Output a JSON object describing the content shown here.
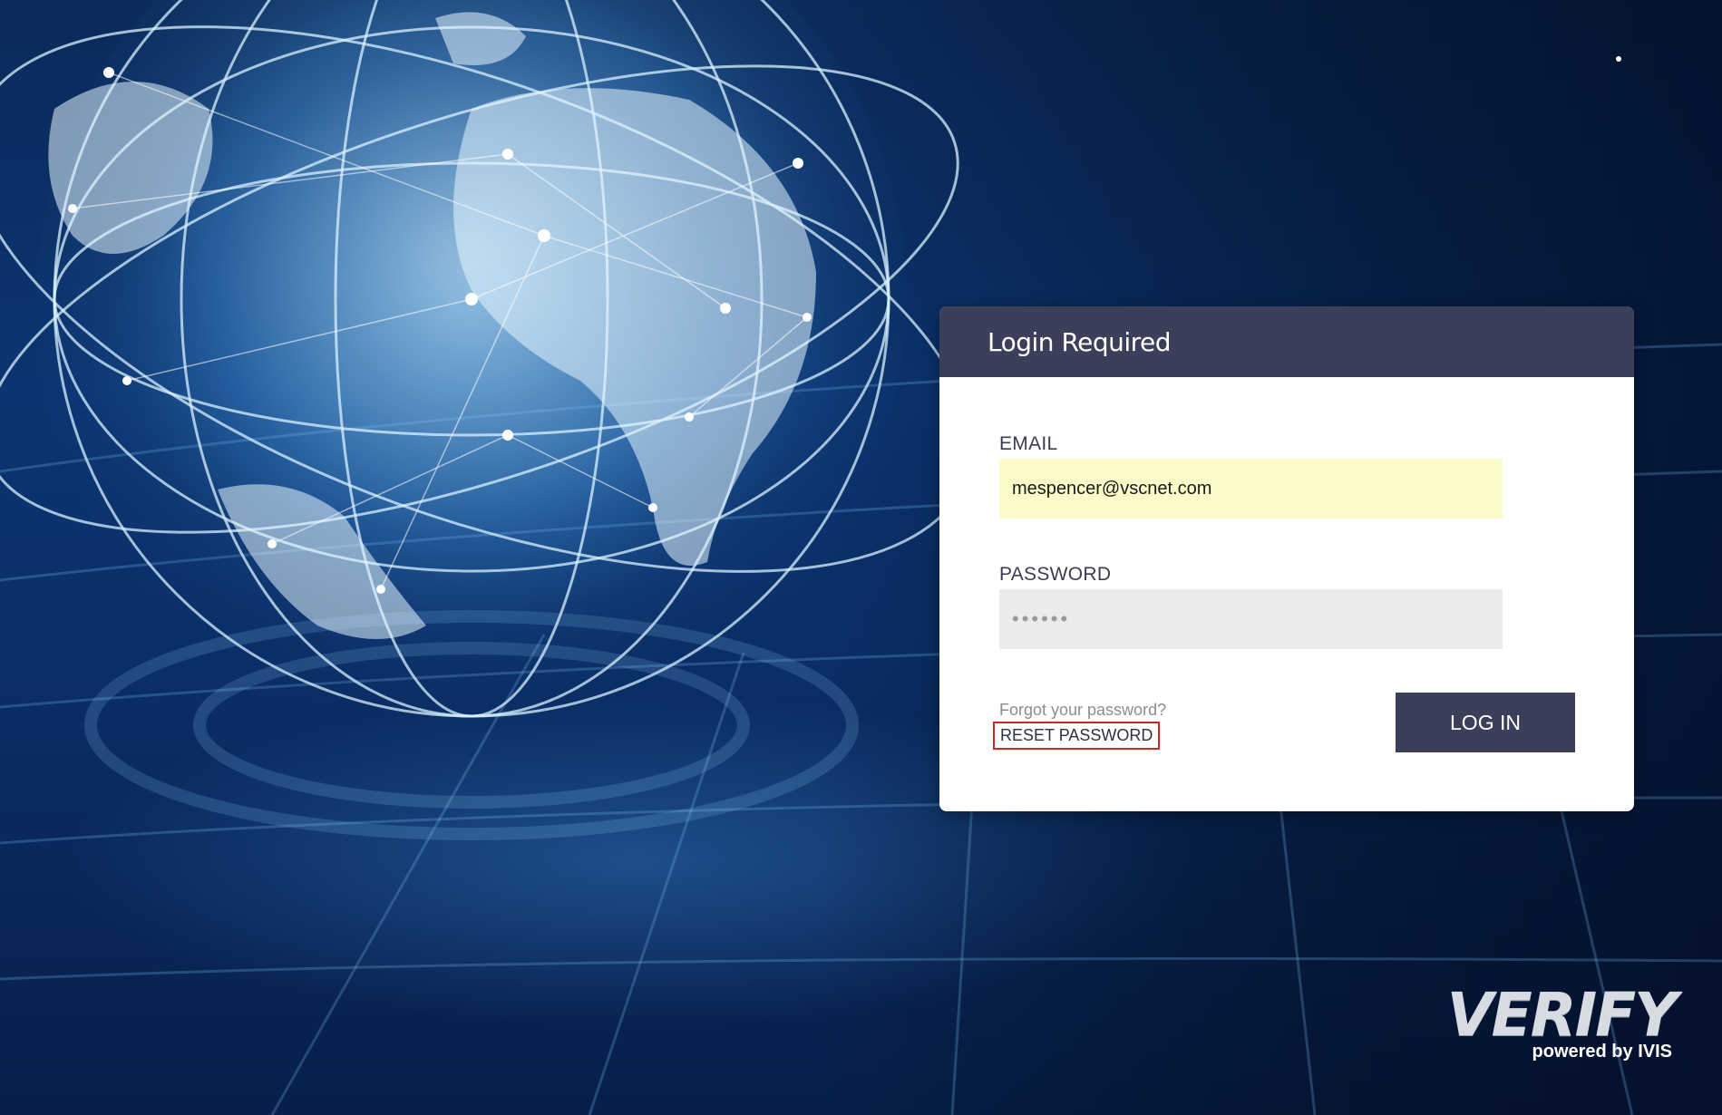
{
  "login": {
    "title": "Login Required",
    "email_label": "EMAIL",
    "email_value": "mespencer@vscnet.com",
    "password_label": "PASSWORD",
    "password_value": "••••••",
    "forgot_text": "Forgot your password?",
    "reset_label": "RESET PASSWORD",
    "login_label": "LOG IN"
  },
  "branding": {
    "logo_text": "VERIFY",
    "powered_by": "powered by IVIS"
  },
  "colors": {
    "header_bg": "#3b3f59",
    "button_bg": "#3b3f59",
    "email_field_bg": "#fafbc8",
    "password_field_bg": "#ececec",
    "highlight_border": "#d62424"
  }
}
